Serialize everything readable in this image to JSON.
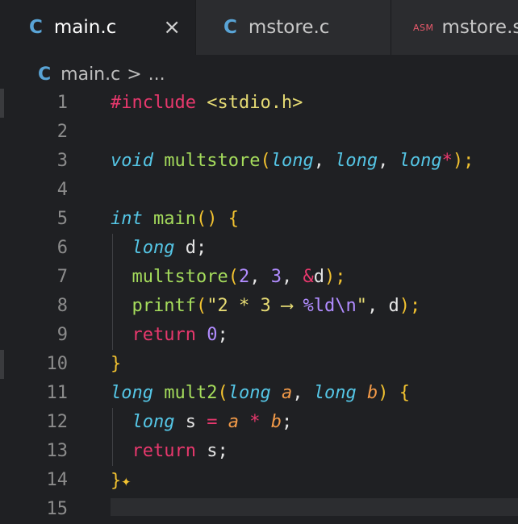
{
  "tabs": [
    {
      "icon": "C",
      "label": "main.c",
      "close": "×",
      "active": true
    },
    {
      "icon": "C",
      "label": "mstore.c",
      "active": false
    },
    {
      "icon": "ASM",
      "label": "mstore.s",
      "active": false
    }
  ],
  "breadcrumb": {
    "icon": "C",
    "file": "main.c",
    "separator": ">",
    "more": "..."
  },
  "line_numbers": [
    "1",
    "2",
    "3",
    "4",
    "5",
    "6",
    "7",
    "8",
    "9",
    "10",
    "11",
    "12",
    "13",
    "14",
    "15"
  ],
  "code": {
    "l1": {
      "directive": "#include",
      "header": "<stdio.h>"
    },
    "l3": {
      "type": "void",
      "name": "multstore",
      "t1": "long",
      "t2": "long",
      "t3": "long",
      "ptr": "*",
      "end": ");"
    },
    "l5": {
      "type": "int",
      "name": "main",
      "parens": "()",
      "brace": "{"
    },
    "l6": {
      "type": "long",
      "var": "d",
      "semi": ";"
    },
    "l7": {
      "name": "multstore",
      "a1": "2",
      "a2": "3",
      "amp": "&",
      "var": "d",
      "end": ");"
    },
    "l8": {
      "name": "printf",
      "str1": "\"2 * 3 ⟶ ",
      "fmt": "%ld",
      "esc": "\\n",
      "str2": "\"",
      "var": "d",
      "end": ");"
    },
    "l9": {
      "kw": "return",
      "val": "0",
      "semi": ";"
    },
    "l10": {
      "brace": "}"
    },
    "l11": {
      "type": "long",
      "name": "mult2",
      "t1": "long",
      "p1": "a",
      "t2": "long",
      "p2": "b",
      "brace": "{"
    },
    "l12": {
      "type": "long",
      "var": "s",
      "eq": "=",
      "a": "a",
      "mul": "*",
      "b": "b",
      "semi": ";"
    },
    "l13": {
      "kw": "return",
      "var": "s",
      "semi": ";"
    },
    "l14": {
      "brace": "}"
    }
  },
  "colors": {
    "background": "#1f2023",
    "tabbar": "#2b2c2f",
    "keyword": "#55c6e6",
    "function": "#a5dc5c",
    "string": "#e6db74",
    "preproc": "#e8386d",
    "number": "#b18cff"
  }
}
